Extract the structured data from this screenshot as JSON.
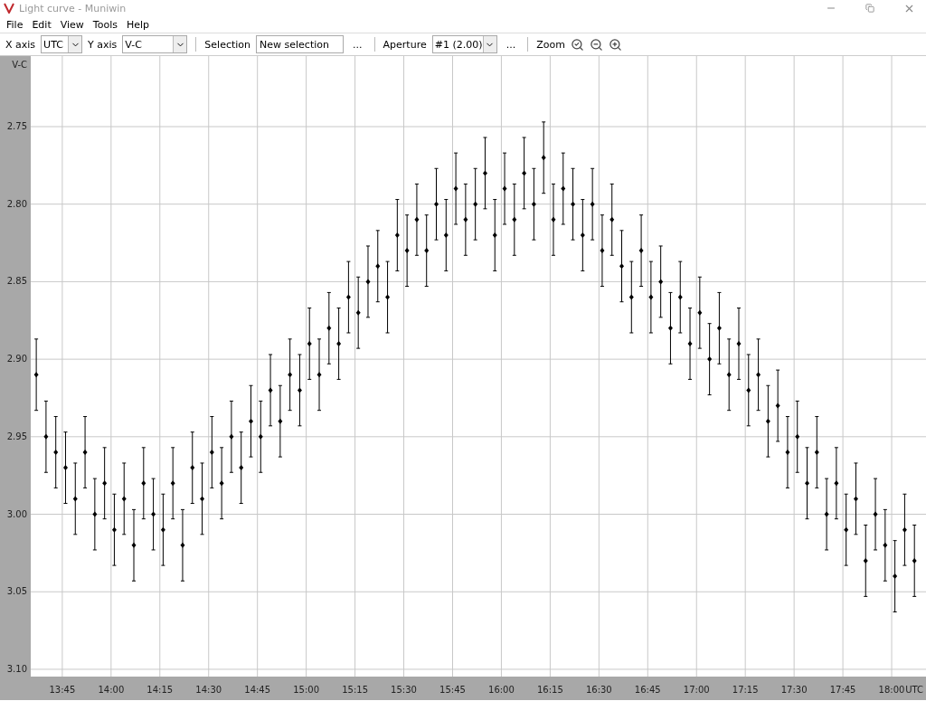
{
  "window": {
    "title": "Light curve - Muniwin"
  },
  "menu": [
    "File",
    "Edit",
    "View",
    "Tools",
    "Help"
  ],
  "toolbar": [
    {
      "kind": "label",
      "text": "X axis"
    },
    {
      "kind": "select",
      "value": "UTC"
    },
    {
      "kind": "label",
      "text": "Y axis"
    },
    {
      "kind": "select",
      "value": "V-C"
    },
    {
      "kind": "separator"
    },
    {
      "kind": "label",
      "text": "Selection"
    },
    {
      "kind": "field",
      "value": "New selection"
    },
    {
      "kind": "button",
      "text": "..."
    },
    {
      "kind": "separator"
    },
    {
      "kind": "label",
      "text": "Aperture"
    },
    {
      "kind": "select",
      "value": "#1 (2.00)"
    },
    {
      "kind": "button",
      "text": "..."
    },
    {
      "kind": "separator"
    },
    {
      "kind": "label",
      "text": "Zoom"
    },
    {
      "kind": "icon"
    },
    {
      "kind": "icon"
    },
    {
      "kind": "icon"
    }
  ],
  "chart": {
    "chart_data": {
      "type": "scatter",
      "ylabel": "V-C",
      "xlabel": "UTC",
      "xlim": [
        815.3,
        1090
      ],
      "ylim": [
        3.1047,
        2.7045
      ],
      "grid": true,
      "xticks": [
        {
          "value": 825,
          "label": "13:45"
        },
        {
          "value": 840,
          "label": "14:00"
        },
        {
          "value": 855,
          "label": "14:15"
        },
        {
          "value": 870,
          "label": "14:30"
        },
        {
          "value": 885,
          "label": "14:45"
        },
        {
          "value": 900,
          "label": "15:00"
        },
        {
          "value": 915,
          "label": "15:15"
        },
        {
          "value": 930,
          "label": "15:30"
        },
        {
          "value": 945,
          "label": "15:45"
        },
        {
          "value": 960,
          "label": "16:00"
        },
        {
          "value": 975,
          "label": "16:15"
        },
        {
          "value": 990,
          "label": "16:30"
        },
        {
          "value": 1005,
          "label": "16:45"
        },
        {
          "value": 1020,
          "label": "17:00"
        },
        {
          "value": 1035,
          "label": "17:15"
        },
        {
          "value": 1050,
          "label": "17:30"
        },
        {
          "value": 1065,
          "label": "17:45"
        },
        {
          "value": 1080,
          "label": "18:00"
        }
      ],
      "yticks": [
        {
          "value": 2.75,
          "label": "2.75"
        },
        {
          "value": 2.8,
          "label": "2.80"
        },
        {
          "value": 2.85,
          "label": "2.85"
        },
        {
          "value": 2.9,
          "label": "2.90"
        },
        {
          "value": 2.95,
          "label": "2.95"
        },
        {
          "value": 3.0,
          "label": "3.00"
        },
        {
          "value": 3.05,
          "label": "3.05"
        },
        {
          "value": 3.1,
          "label": "3.10"
        }
      ],
      "x": [
        817,
        820,
        823,
        826,
        829,
        832,
        835,
        838,
        841,
        844,
        847,
        850,
        853,
        856,
        859,
        862,
        865,
        868,
        871,
        874,
        877,
        880,
        883,
        886,
        889,
        892,
        895,
        898,
        901,
        904,
        907,
        910,
        913,
        916,
        919,
        922,
        925,
        928,
        931,
        934,
        937,
        940,
        943,
        946,
        949,
        952,
        955,
        958,
        961,
        964,
        967,
        970,
        973,
        976,
        979,
        982,
        985,
        988,
        991,
        994,
        997,
        1000,
        1003,
        1006,
        1009,
        1012,
        1015,
        1018,
        1021,
        1024,
        1027,
        1030,
        1033,
        1036,
        1039,
        1042,
        1045,
        1048,
        1051,
        1054,
        1057,
        1060,
        1063,
        1066,
        1069,
        1072,
        1075,
        1078,
        1081,
        1084,
        1087
      ],
      "series": [
        {
          "color": "#000000",
          "errors": [
            0.023,
            0.023,
            0.023,
            0.023,
            0.023,
            0.023,
            0.023,
            0.023,
            0.023,
            0.023,
            0.023,
            0.023,
            0.023,
            0.023,
            0.023,
            0.023,
            0.023,
            0.023,
            0.023,
            0.023,
            0.023,
            0.023,
            0.023,
            0.023,
            0.023,
            0.023,
            0.023,
            0.023,
            0.023,
            0.023,
            0.023,
            0.023,
            0.023,
            0.023,
            0.023,
            0.023,
            0.023,
            0.023,
            0.023,
            0.023,
            0.023,
            0.023,
            0.023,
            0.023,
            0.023,
            0.023,
            0.023,
            0.023,
            0.023,
            0.023,
            0.023,
            0.023,
            0.023,
            0.023,
            0.023,
            0.023,
            0.023,
            0.023,
            0.023,
            0.023,
            0.023,
            0.023,
            0.023,
            0.023,
            0.023,
            0.023,
            0.023,
            0.023,
            0.023,
            0.023,
            0.023,
            0.023,
            0.023,
            0.023,
            0.023,
            0.023,
            0.023,
            0.023,
            0.023,
            0.023,
            0.023,
            0.023,
            0.023,
            0.023,
            0.023,
            0.023,
            0.023,
            0.023,
            0.023,
            0.023,
            0.023
          ],
          "values": [
            2.91,
            2.95,
            2.96,
            2.97,
            2.99,
            2.96,
            3.0,
            2.98,
            3.01,
            2.99,
            3.02,
            2.98,
            3.0,
            3.01,
            2.98,
            3.02,
            2.97,
            2.99,
            2.96,
            2.98,
            2.95,
            2.97,
            2.94,
            2.95,
            2.92,
            2.94,
            2.91,
            2.92,
            2.89,
            2.91,
            2.88,
            2.89,
            2.86,
            2.87,
            2.85,
            2.84,
            2.86,
            2.82,
            2.83,
            2.81,
            2.83,
            2.8,
            2.82,
            2.79,
            2.81,
            2.8,
            2.78,
            2.82,
            2.79,
            2.81,
            2.78,
            2.8,
            2.77,
            2.81,
            2.79,
            2.8,
            2.82,
            2.8,
            2.83,
            2.81,
            2.84,
            2.86,
            2.83,
            2.86,
            2.85,
            2.88,
            2.86,
            2.89,
            2.87,
            2.9,
            2.88,
            2.91,
            2.89,
            2.92,
            2.91,
            2.94,
            2.93,
            2.96,
            2.95,
            2.98,
            2.96,
            3.0,
            2.98,
            3.01,
            2.99,
            3.03,
            3.0,
            3.02,
            3.04,
            3.01,
            3.03
          ]
        }
      ]
    }
  }
}
